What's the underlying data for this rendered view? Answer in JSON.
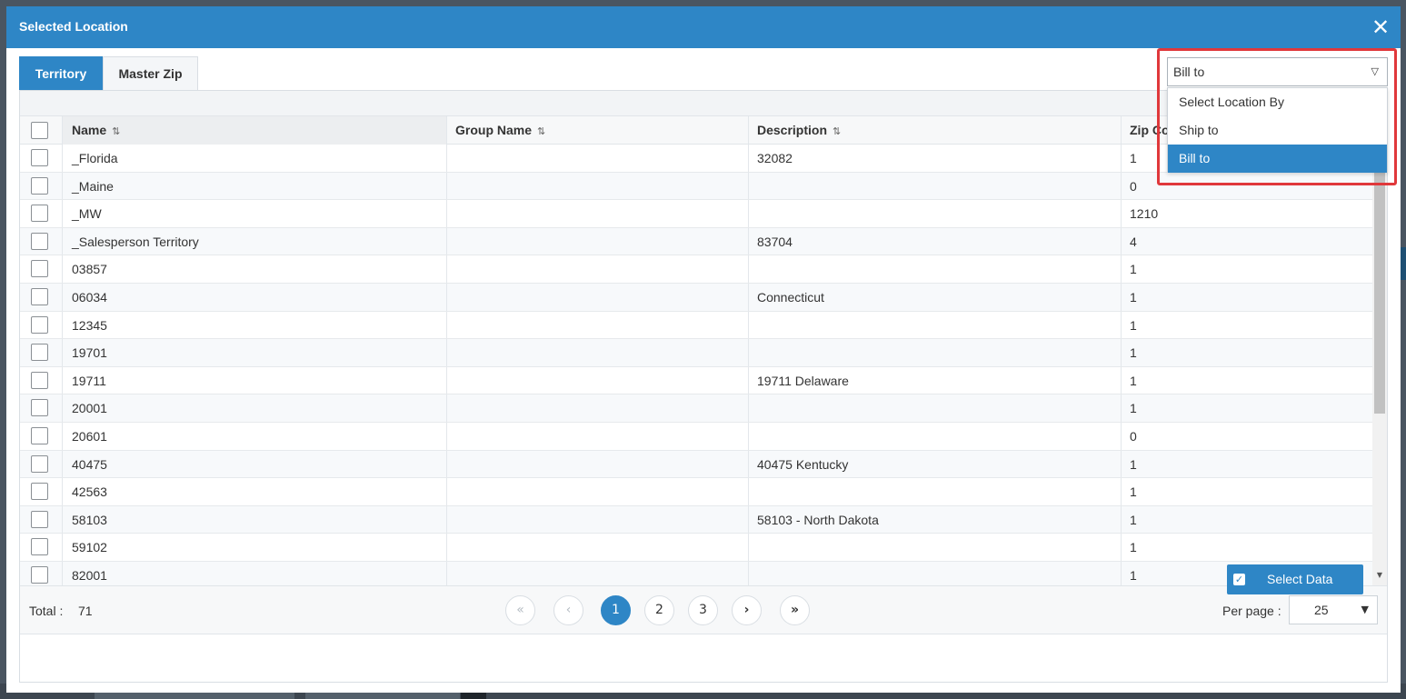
{
  "modal": {
    "title": "Selected Location",
    "close_glyph": "✕"
  },
  "tabs": [
    {
      "label": "Territory",
      "active": true
    },
    {
      "label": "Master Zip",
      "active": false
    }
  ],
  "location_select": {
    "value": "Bill to",
    "options": [
      "Select Location By",
      "Ship to",
      "Bill to"
    ],
    "selected_index": 2
  },
  "grid": {
    "columns": [
      {
        "label": "Name",
        "sort_icon": "sort-asc-icon"
      },
      {
        "label": "Group Name",
        "sort_icon": "sort-icon"
      },
      {
        "label": "Description",
        "sort_icon": "sort-icon"
      },
      {
        "label": "Zip Co",
        "sort_icon": ""
      }
    ],
    "rows": [
      {
        "name": "_Florida",
        "group": "",
        "description": "32082",
        "zip": "1"
      },
      {
        "name": "_Maine",
        "group": "",
        "description": "",
        "zip": "0"
      },
      {
        "name": "_MW",
        "group": "",
        "description": "",
        "zip": "1210"
      },
      {
        "name": "_Salesperson Territory",
        "group": "",
        "description": "83704",
        "zip": "4"
      },
      {
        "name": "03857",
        "group": "",
        "description": "",
        "zip": "1"
      },
      {
        "name": "06034",
        "group": "",
        "description": "Connecticut",
        "zip": "1"
      },
      {
        "name": "12345",
        "group": "",
        "description": "",
        "zip": "1"
      },
      {
        "name": "19701",
        "group": "",
        "description": "",
        "zip": "1"
      },
      {
        "name": "19711",
        "group": "",
        "description": "19711 Delaware",
        "zip": "1"
      },
      {
        "name": "20001",
        "group": "",
        "description": "",
        "zip": "1"
      },
      {
        "name": "20601",
        "group": "",
        "description": "",
        "zip": "0"
      },
      {
        "name": "40475",
        "group": "",
        "description": "40475 Kentucky",
        "zip": "1"
      },
      {
        "name": "42563",
        "group": "",
        "description": "",
        "zip": "1"
      },
      {
        "name": "58103",
        "group": "",
        "description": "58103 - North Dakota",
        "zip": "1"
      },
      {
        "name": "59102",
        "group": "",
        "description": "",
        "zip": "1"
      },
      {
        "name": "82001",
        "group": "",
        "description": "",
        "zip": "1"
      }
    ]
  },
  "footer": {
    "total_label": "Total :",
    "total_value": "71",
    "pagination": {
      "first": "«",
      "prev": "‹",
      "pages": [
        "1",
        "2",
        "3"
      ],
      "current": "1",
      "next": "›",
      "last": "»"
    },
    "per_page_label": "Per page :",
    "per_page_value": "25"
  },
  "actions": {
    "select_data_label": "Select Data"
  },
  "colors": {
    "primary": "#2e86c6",
    "highlight_border": "#e0383b"
  }
}
